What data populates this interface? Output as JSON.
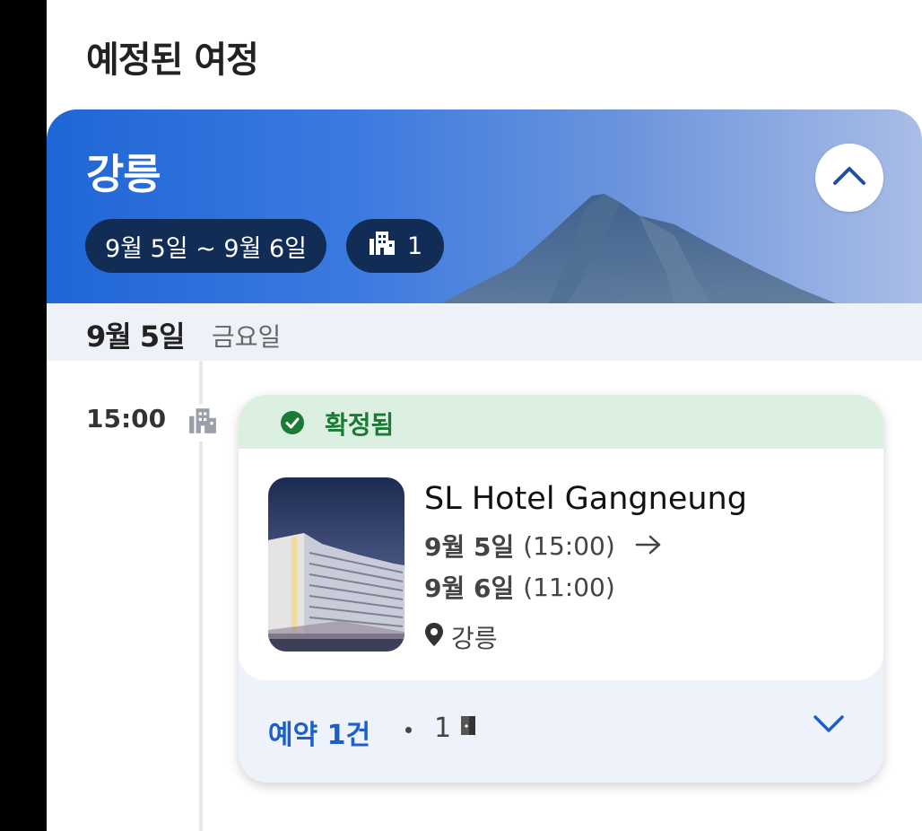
{
  "page": {
    "title": "예정된 여정"
  },
  "trip": {
    "city": "강릉",
    "date_range": "9월 5일 ~ 9월 6일",
    "hotel_count": "1",
    "collapse_icon": "chevron-up-icon",
    "accent_color": "#1f66d6"
  },
  "day": {
    "date": "9월 5일",
    "weekday": "금요일"
  },
  "booking": {
    "time": "15:00",
    "status": "확정됨",
    "status_color": "#1b7a35",
    "hotel_name": "SL Hotel Gangneung",
    "checkin_date": "9월 5일",
    "checkin_time": "(15:00)",
    "checkout_date": "9월 6일",
    "checkout_time": "(11:00)",
    "location": "강릉",
    "reservation_count": "예약 1건",
    "room_count": "1",
    "expand_icon": "chevron-down-icon"
  }
}
